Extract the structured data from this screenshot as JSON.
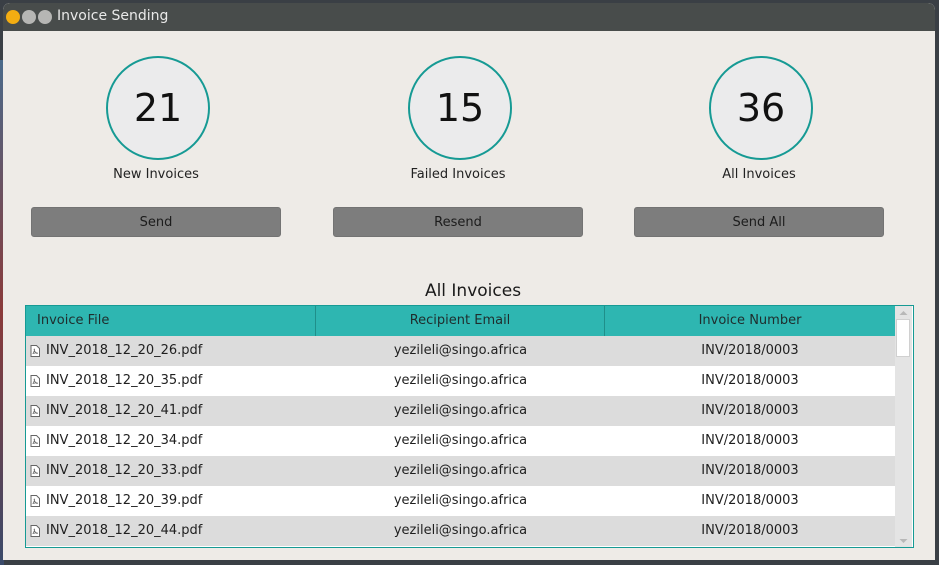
{
  "window": {
    "title": "Invoice Sending"
  },
  "stats": [
    {
      "value": "21",
      "label": "New Invoices",
      "button": "Send"
    },
    {
      "value": "15",
      "label": "Failed Invoices",
      "button": "Resend"
    },
    {
      "value": "36",
      "label": "All Invoices",
      "button": "Send All"
    }
  ],
  "table": {
    "title": "All Invoices",
    "columns": [
      "Invoice File",
      "Recipient Email",
      "Invoice Number"
    ],
    "rows": [
      {
        "file": "INV_2018_12_20_26.pdf",
        "email": "yezileli@singo.africa",
        "number": "INV/2018/0003"
      },
      {
        "file": "INV_2018_12_20_35.pdf",
        "email": "yezileli@singo.africa",
        "number": "INV/2018/0003"
      },
      {
        "file": "INV_2018_12_20_41.pdf",
        "email": "yezileli@singo.africa",
        "number": "INV/2018/0003"
      },
      {
        "file": "INV_2018_12_20_34.pdf",
        "email": "yezileli@singo.africa",
        "number": "INV/2018/0003"
      },
      {
        "file": "INV_2018_12_20_33.pdf",
        "email": "yezileli@singo.africa",
        "number": "INV/2018/0003"
      },
      {
        "file": "INV_2018_12_20_39.pdf",
        "email": "yezileli@singo.africa",
        "number": "INV/2018/0003"
      },
      {
        "file": "INV_2018_12_20_44.pdf",
        "email": "yezileli@singo.africa",
        "number": "INV/2018/0003"
      }
    ]
  },
  "colors": {
    "accent": "#169a94",
    "header": "#2eb6b1",
    "button": "#7d7d7d",
    "titlebar": "#484c4b"
  },
  "icons": {
    "file": "pdf-file-icon"
  }
}
